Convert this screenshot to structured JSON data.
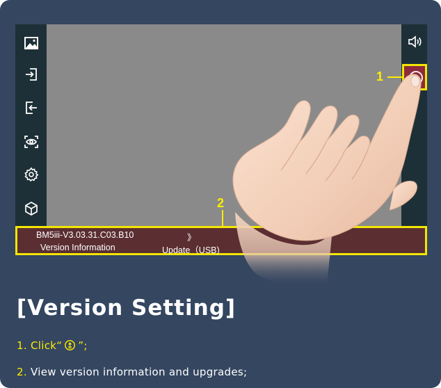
{
  "device": {
    "left_icons": [
      "gallery-icon",
      "import-icon",
      "export-icon",
      "eye-scan-icon",
      "settings-icon",
      "cube-icon"
    ],
    "right_icons": [
      "speaker-icon",
      "upgrade-icon"
    ]
  },
  "callouts": {
    "one": "1",
    "two": "2"
  },
  "info_bar": {
    "version": "BM5iii-V3.03.31.C03.B10",
    "version_label": "Version Information",
    "chevron": "》",
    "update_label": "Update（USB)"
  },
  "caption": {
    "title": "[Version Setting]",
    "step1_num": "1.",
    "step1_pre": "Click“",
    "step1_post": "”;",
    "step2_num": "2.",
    "step2_text": "View version information and upgrades;"
  },
  "colors": {
    "background": "#344660",
    "device_frame": "#1e3037",
    "screen": "#8a8a8a",
    "highlight": "#f3e600",
    "info_bar": "#5b2e31",
    "accent_text": "#ffec00"
  }
}
